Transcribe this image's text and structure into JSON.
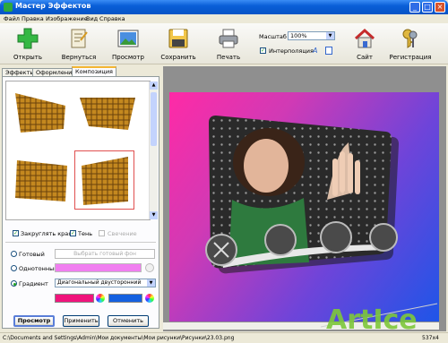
{
  "window": {
    "title": "Мастер Эффектов",
    "minimize": "_",
    "maximize": "□",
    "close": "×"
  },
  "menu": [
    "Файл",
    "Правка",
    "Изображение",
    "Вид",
    "Справка"
  ],
  "toolbar": {
    "open": "Открыть",
    "undo": "Вернуться",
    "preview": "Просмотр",
    "save": "Сохранить",
    "print": "Печать",
    "site": "Сайт",
    "register": "Регистрация",
    "zoom_label": "Масштаб",
    "zoom_value": "100%",
    "interpolation_label": "Интерполяция",
    "interpolation_checked": true
  },
  "tabs": [
    "Эффекты",
    "Оформление",
    "Композиция"
  ],
  "active_tab": "Композиция",
  "options": {
    "round_corners": "Закруглять края",
    "shadow": "Тень",
    "glow": "Свечение"
  },
  "background": {
    "ready": "Готовый",
    "ready_placeholder": "Выбрать готовый фон",
    "solid": "Однотонный",
    "gradient": "Градиент",
    "gradient_type": "Диагональный двусторонний",
    "solid_color": "#f07ef0",
    "gradient_color_1": "#f0147c",
    "gradient_color_2": "#1460e0"
  },
  "buttons": {
    "preview": "Просмотр",
    "apply": "Применить",
    "cancel": "Отменить"
  },
  "status": {
    "path": "C:\\Documents and Settings\\Admin\\Мои документы\\Мои рисунки\\Рисунки\\23.03.png",
    "size": "537x4"
  },
  "watermark": "ArtIce"
}
